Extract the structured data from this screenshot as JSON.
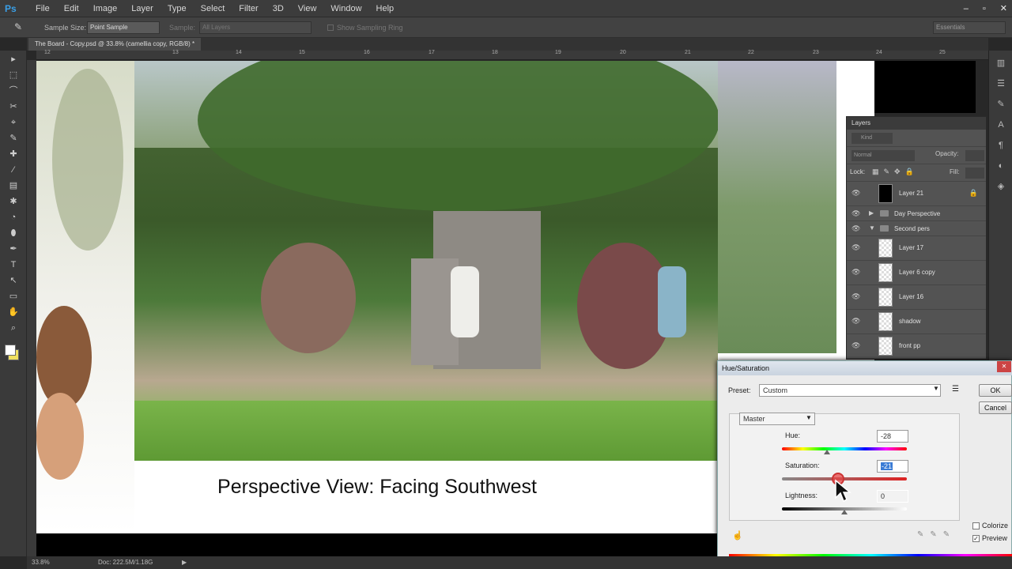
{
  "app": {
    "logo": "Ps",
    "menu": [
      "File",
      "Edit",
      "Image",
      "Layer",
      "Type",
      "Select",
      "Filter",
      "3D",
      "View",
      "Window",
      "Help"
    ],
    "window_controls": [
      "–",
      "▫",
      "✕"
    ]
  },
  "options": {
    "sample_size_label": "Sample Size:",
    "sample_size_value": "Point Sample",
    "sample_label": "Sample:",
    "sample_value": "All Layers",
    "show_ring_label": "Show Sampling Ring",
    "workspace": "Essentials"
  },
  "document": {
    "tab_title": "The Board - Copy.psd @ 33.8% (camellia copy, RGB/8) *",
    "caption": "Perspective View: Facing Southwest",
    "zoom": "33.8%",
    "doc_size": "Doc: 222.5M/1.18G"
  },
  "ruler": {
    "top_ticks": [
      "12",
      "13",
      "14",
      "15",
      "16",
      "17",
      "18",
      "19",
      "20",
      "21",
      "22",
      "23",
      "24",
      "25"
    ]
  },
  "tools": [
    "▸",
    "⬚",
    "⌒",
    "✂",
    "⌖",
    "✎",
    "✚",
    "⁄",
    "▤",
    "✱",
    "◔",
    "⬮",
    "✒",
    "T",
    "↖",
    "▭",
    "✋",
    "⌕"
  ],
  "layers": {
    "title": "Layers",
    "kind_label": "Kind",
    "blend_mode": "Normal",
    "opacity_label": "Opacity:",
    "lock_label": "Lock:",
    "fill_label": "Fill:",
    "rows": [
      {
        "name": "Layer 21",
        "type": "layer",
        "thumb": "black"
      },
      {
        "name": "Day Perspective",
        "type": "group",
        "arrow": "▶"
      },
      {
        "name": "Second pers",
        "type": "group",
        "arrow": "▼"
      },
      {
        "name": "Layer 17",
        "type": "layer",
        "thumb": "checker"
      },
      {
        "name": "Layer 6 copy",
        "type": "layer",
        "thumb": "checker"
      },
      {
        "name": "Layer 16",
        "type": "layer",
        "thumb": "checker"
      },
      {
        "name": "shadow",
        "type": "layer",
        "thumb": "checker"
      },
      {
        "name": "front pp",
        "type": "layer",
        "thumb": "checker"
      }
    ]
  },
  "hue_saturation": {
    "title": "Hue/Saturation",
    "preset_label": "Preset:",
    "preset_value": "Custom",
    "channel": "Master",
    "hue_label": "Hue:",
    "hue_value": "-28",
    "saturation_label": "Saturation:",
    "saturation_value": "-21",
    "lightness_label": "Lightness:",
    "lightness_value": "0",
    "ok_label": "OK",
    "cancel_label": "Cancel",
    "colorize_label": "Colorize",
    "preview_label": "Preview",
    "colorize_checked": false,
    "preview_checked": true,
    "hue_level": 0.36,
    "saturation_level": 0.45,
    "lightness_level": 0.5
  },
  "colors": {
    "accent": "#3aa0e8",
    "panel": "#535353",
    "dialog": "#ececec"
  }
}
